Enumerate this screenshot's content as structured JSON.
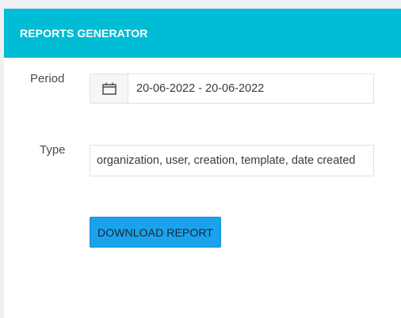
{
  "panel": {
    "title": "REPORTS GENERATOR"
  },
  "form": {
    "period": {
      "label": "Period",
      "icon": "calendar-icon",
      "value": "20-06-2022 - 20-06-2022"
    },
    "type": {
      "label": "Type",
      "value": "organization, user, creation, template, date created"
    },
    "download_label": "DOWNLOAD REPORT"
  },
  "colors": {
    "header": "#00bcd4",
    "button": "#1aa3ec"
  }
}
